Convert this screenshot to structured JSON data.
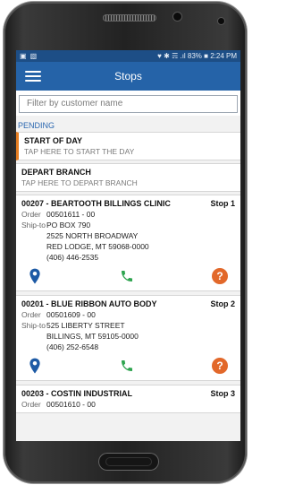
{
  "status": {
    "right": "♥ ✱ ☴ .ıl 83% ■ 2:24 PM"
  },
  "app": {
    "title": "Stops"
  },
  "filter": {
    "placeholder": "Filter by customer name"
  },
  "section": {
    "pending": "PENDING"
  },
  "cards": [
    {
      "title": "START OF DAY",
      "subtitle": "TAP HERE TO START THE DAY"
    },
    {
      "title": "DEPART BRANCH",
      "subtitle": "TAP HERE TO DEPART BRANCH"
    }
  ],
  "labels": {
    "order": "Order",
    "ship_to": "Ship-to"
  },
  "stops": [
    {
      "code": "00207 -  BEARTOOTH BILLINGS CLINIC",
      "stop": "Stop 1",
      "order": "00501611 - 00",
      "ship_line1": "PO BOX 790",
      "ship_line2": "2525 NORTH BROADWAY",
      "ship_line3": "RED LODGE, MT 59068-0000",
      "phone": "(406) 446-2535"
    },
    {
      "code": "00201 -  BLUE RIBBON AUTO BODY",
      "stop": "Stop 2",
      "order": "00501609 - 00",
      "ship_line1": "525 LIBERTY STREET",
      "ship_line2": "BILLINGS, MT 59105-0000",
      "phone": "(406) 252-6548"
    },
    {
      "code": "00203 -  COSTIN INDUSTRIAL",
      "stop": "Stop 3",
      "order": "00501610 - 00"
    }
  ],
  "colors": {
    "appbar": "#2563a8",
    "accent": "#e67e22",
    "help": "#e2682a",
    "pin": "#1d5aa5",
    "phone": "#2ea44f"
  },
  "icons": {
    "menu": "hamburger-icon",
    "map": "map-pin-icon",
    "call": "phone-icon",
    "help": "help-icon"
  }
}
